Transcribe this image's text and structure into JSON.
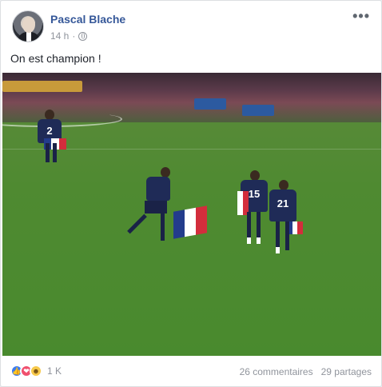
{
  "post": {
    "author": "Pascal Blache",
    "time": "14 h",
    "dot": "·",
    "more": "•••",
    "message": "On est champion !"
  },
  "photo": {
    "jersey_numbers": [
      "15",
      "21",
      "2"
    ]
  },
  "footer": {
    "reaction_count": "1 K",
    "comments": "26 commentaires",
    "shares": "29 partages"
  },
  "icons": {
    "like": "like-icon",
    "love": "love-icon",
    "haha": "haha-icon",
    "privacy": "globe-icon"
  }
}
